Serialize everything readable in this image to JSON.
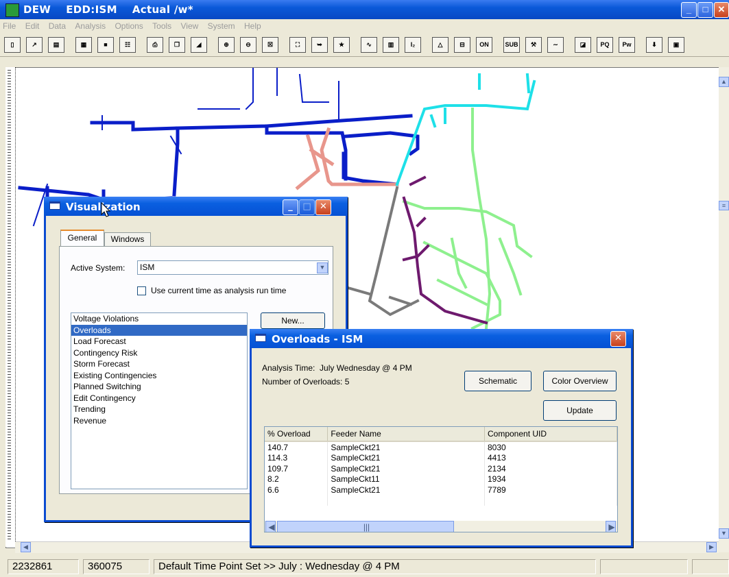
{
  "window": {
    "title": "DEW    EDD:ISM    Actual /w*"
  },
  "menu": [
    "File",
    "Edit",
    "Data",
    "Analysis",
    "Options",
    "Tools",
    "View",
    "System",
    "Help"
  ],
  "toolbar": {
    "buttons": [
      {
        "name": "new-icon",
        "glyph": "▯"
      },
      {
        "name": "open-icon",
        "glyph": "↗"
      },
      {
        "name": "folder-icon",
        "glyph": "▤"
      },
      {
        "name": "import-icon",
        "glyph": "▦"
      },
      {
        "name": "save-icon",
        "glyph": "■"
      },
      {
        "name": "report-icon",
        "glyph": "☷"
      },
      {
        "name": "print-icon",
        "glyph": "⎙"
      },
      {
        "name": "copy-icon",
        "glyph": "❐"
      },
      {
        "name": "eraser-icon",
        "glyph": "◢"
      },
      {
        "name": "zoom-in-icon",
        "glyph": "⊕"
      },
      {
        "name": "zoom-out-icon",
        "glyph": "⊖"
      },
      {
        "name": "zoom-extent-icon",
        "glyph": "☒"
      },
      {
        "name": "zoom-fit-icon",
        "glyph": "⛶"
      },
      {
        "name": "arrow-right-icon",
        "glyph": "➥"
      },
      {
        "name": "run-icon",
        "glyph": "★"
      },
      {
        "name": "chart-icon",
        "glyph": "∿"
      },
      {
        "name": "book-icon",
        "glyph": "▥"
      },
      {
        "name": "ie-icon",
        "glyph": "I₂"
      },
      {
        "name": "triangle-icon",
        "glyph": "△"
      },
      {
        "name": "switch-icon",
        "glyph": "⊟"
      },
      {
        "name": "on-off-icon",
        "glyph": "ON"
      },
      {
        "name": "sub-icon",
        "glyph": "SUB"
      },
      {
        "name": "tools-icon",
        "glyph": "⚒"
      },
      {
        "name": "wave-icon",
        "glyph": "∼"
      },
      {
        "name": "warning-icon",
        "glyph": "◪"
      },
      {
        "name": "pq-icon",
        "glyph": "PQ"
      },
      {
        "name": "pw-icon",
        "glyph": "Pw"
      },
      {
        "name": "down-arrow-icon",
        "glyph": "⬇"
      },
      {
        "name": "monitor-icon",
        "glyph": "▣"
      }
    ]
  },
  "visualization": {
    "title": "Visualization",
    "tabs": [
      "General",
      "Windows"
    ],
    "active_system_label": "Active System:",
    "active_system_value": "ISM",
    "checkbox_label": "Use current time as analysis run time",
    "list_items": [
      "Voltage Violations",
      "Overloads",
      "Load Forecast",
      "Contingency Risk",
      "Storm Forecast",
      "Existing Contingencies",
      "Planned Switching",
      "Edit Contingency",
      "Trending",
      "Revenue"
    ],
    "selected_item": "Overloads",
    "new_button": "New..."
  },
  "overloads": {
    "title": "Overloads - ISM",
    "analysis_time": "Analysis Time:  July Wednesday @ 4 PM",
    "num_overloads": "Number of Overloads: 5",
    "schematic_button": "Schematic",
    "color_overview_button": "Color Overview",
    "update_button": "Update",
    "columns": [
      "% Overload",
      "Feeder Name",
      "Component UID"
    ],
    "rows": [
      [
        "140.7",
        "SampleCkt21",
        "8030"
      ],
      [
        "114.3",
        "SampleCkt21",
        "4413"
      ],
      [
        "109.7",
        "SampleCkt21",
        "2134"
      ],
      [
        "8.2",
        "SampleCkt11",
        "1934"
      ],
      [
        "6.6",
        "SampleCkt21",
        "7789"
      ]
    ]
  },
  "statusbar": {
    "x": "2232861",
    "y": "360075",
    "message": "Default Time Point Set >> July : Wednesday @  4 PM"
  },
  "colors": {
    "feeder_blue": "#0a1ec8",
    "feeder_cyan": "#1ee0e8",
    "feeder_green": "#8ef08e",
    "feeder_pink": "#e8968c",
    "feeder_purple": "#6e1a6e",
    "feeder_gray": "#7a7a7a"
  }
}
